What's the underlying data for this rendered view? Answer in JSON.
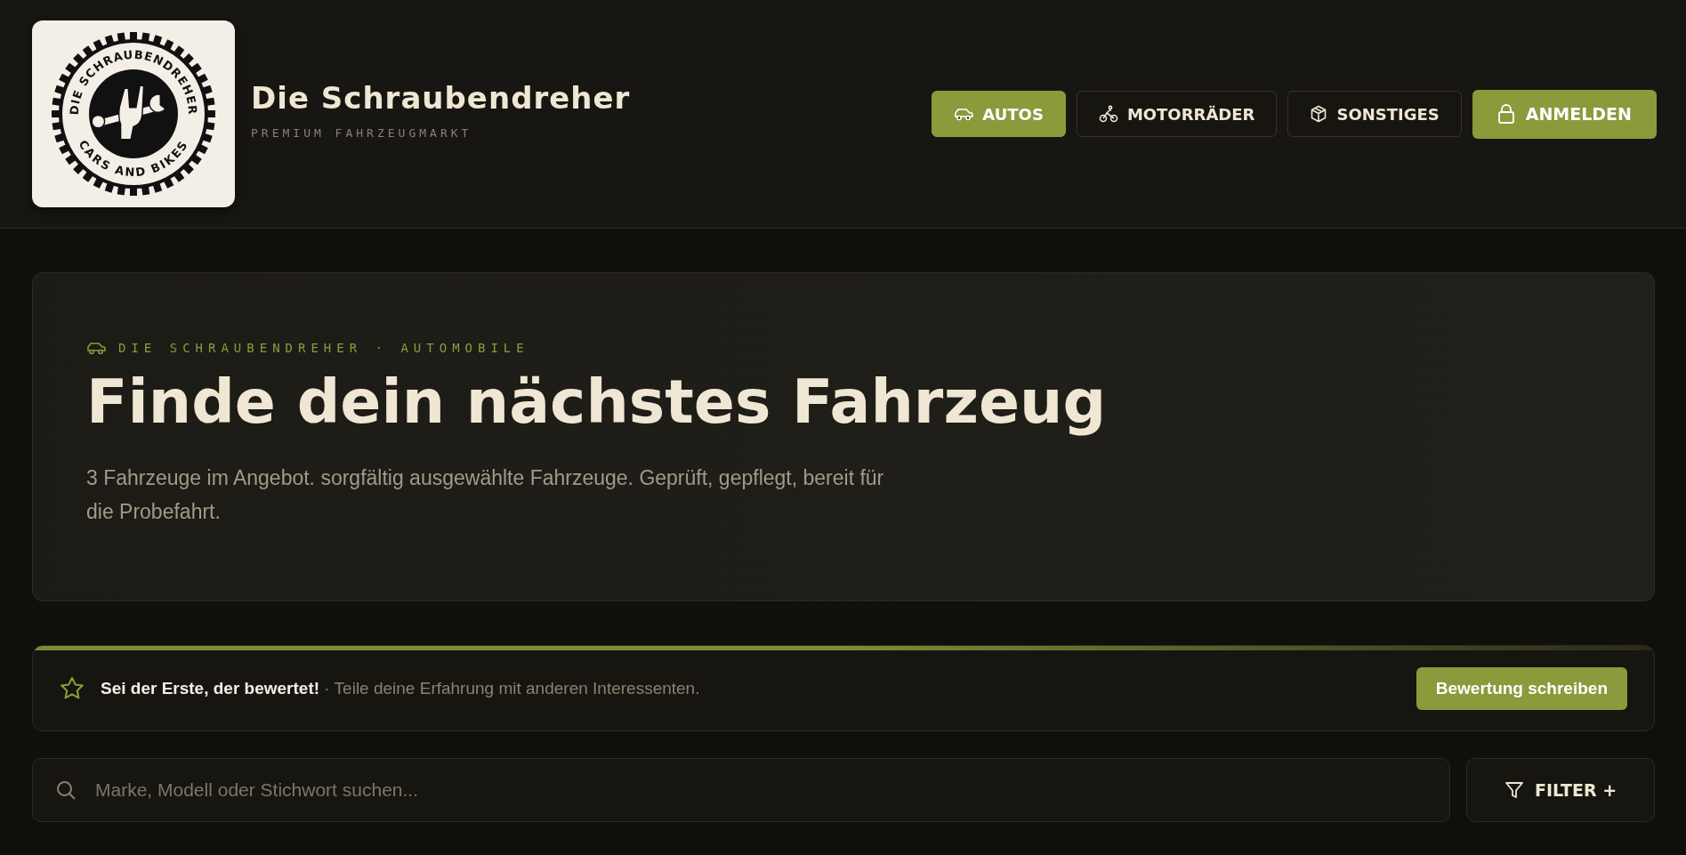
{
  "header": {
    "logo": {
      "top_text": "DIE SCHRAUBENDREHER",
      "bottom_text": "CARS AND BIKES"
    },
    "title": "Die Schraubendreher",
    "subtitle": "PREMIUM FAHRZEUGMARKT",
    "nav": [
      {
        "label": "AUTOS",
        "selected": true
      },
      {
        "label": "MOTORRÄDER",
        "selected": false
      },
      {
        "label": "SONSTIGES",
        "selected": false
      }
    ],
    "login_button": "ANMELDEN"
  },
  "hero": {
    "eyebrow": "DIE SCHRAUBENDREHER · AUTOMOBILE",
    "heading": "Finde dein nächstes Fahrzeug",
    "text": "3 Fahrzeuge im Angebot. sorgfältig ausgewählte Fahrzeuge. Geprüft, gepflegt, bereit für die Probefahrt."
  },
  "review_bar": {
    "text": "**Sei der Erste, der bewertet!** · Teile deine Erfahrung mit anderen Interessenten.",
    "button": "Bewertung schreiben"
  },
  "search": {
    "placeholder": "Marke, Modell oder Stichwort suchen...",
    "filter_button": "FILTER +"
  }
}
